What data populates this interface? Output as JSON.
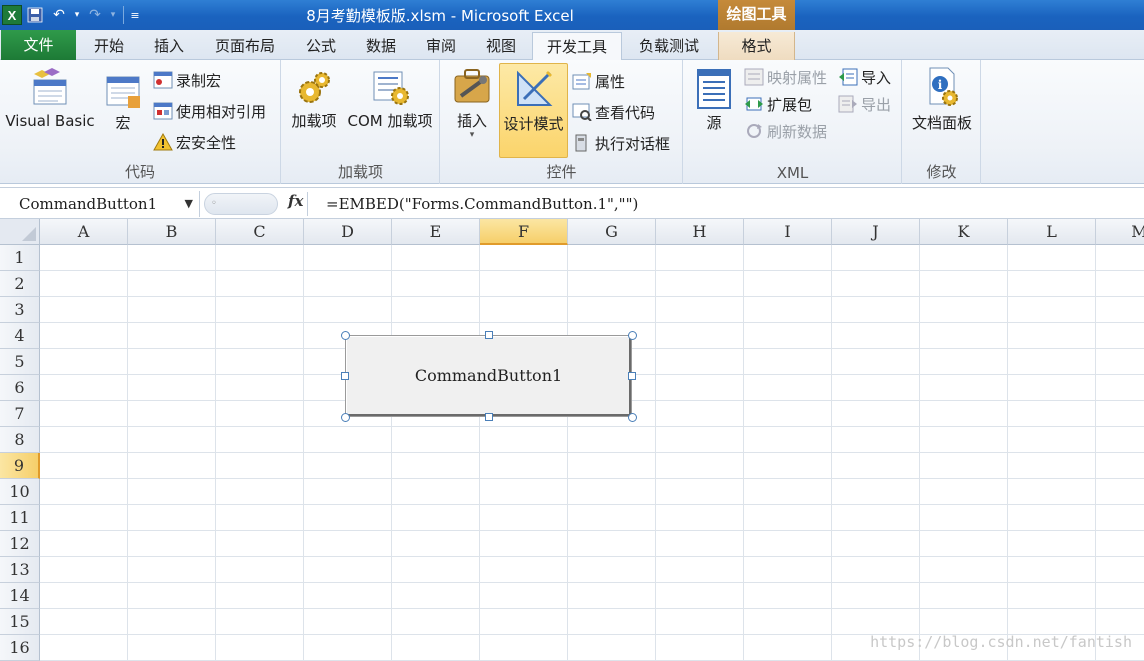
{
  "window": {
    "title": "8月考勤模板版.xlsm  -  Microsoft Excel",
    "context_tab_group": "绘图工具"
  },
  "tabs": [
    {
      "label": "文件"
    },
    {
      "label": "开始"
    },
    {
      "label": "插入"
    },
    {
      "label": "页面布局"
    },
    {
      "label": "公式"
    },
    {
      "label": "数据"
    },
    {
      "label": "审阅"
    },
    {
      "label": "视图"
    },
    {
      "label": "开发工具",
      "active": true
    },
    {
      "label": "负载测试"
    },
    {
      "label": "格式"
    }
  ],
  "ribbon": {
    "code": {
      "label": "代码",
      "visual_basic": "Visual Basic",
      "macro": "宏",
      "record_macro": "录制宏",
      "relative_ref": "使用相对引用",
      "macro_security": "宏安全性"
    },
    "addins": {
      "label": "加载项",
      "addins_btn": "加载项",
      "com_addins": "COM 加载项"
    },
    "controls": {
      "label": "控件",
      "insert": "插入",
      "design_mode": "设计模式",
      "properties": "属性",
      "view_code": "查看代码",
      "run_dialog": "执行对话框"
    },
    "xml": {
      "label": "XML",
      "source": "源",
      "map_properties": "映射属性",
      "expansion_packs": "扩展包",
      "refresh_data": "刷新数据",
      "import": "导入",
      "export": "导出"
    },
    "modify": {
      "label": "修改",
      "document_panel": "文档面板"
    }
  },
  "formula_bar": {
    "name_box": "CommandButton1",
    "fx": "fx",
    "formula": "=EMBED(\"Forms.CommandButton.1\",\"\")"
  },
  "sheet": {
    "columns": [
      "A",
      "B",
      "C",
      "D",
      "E",
      "F",
      "G",
      "H",
      "I",
      "J",
      "K",
      "L",
      "M"
    ],
    "rows": [
      "1",
      "2",
      "3",
      "4",
      "5",
      "6",
      "7",
      "8",
      "9",
      "10",
      "11",
      "12",
      "13",
      "14",
      "15",
      "16"
    ],
    "selected_column": "F",
    "selected_row": "9"
  },
  "command_button": {
    "caption": "CommandButton1"
  },
  "watermark": "https://blog.csdn.net/fantish"
}
